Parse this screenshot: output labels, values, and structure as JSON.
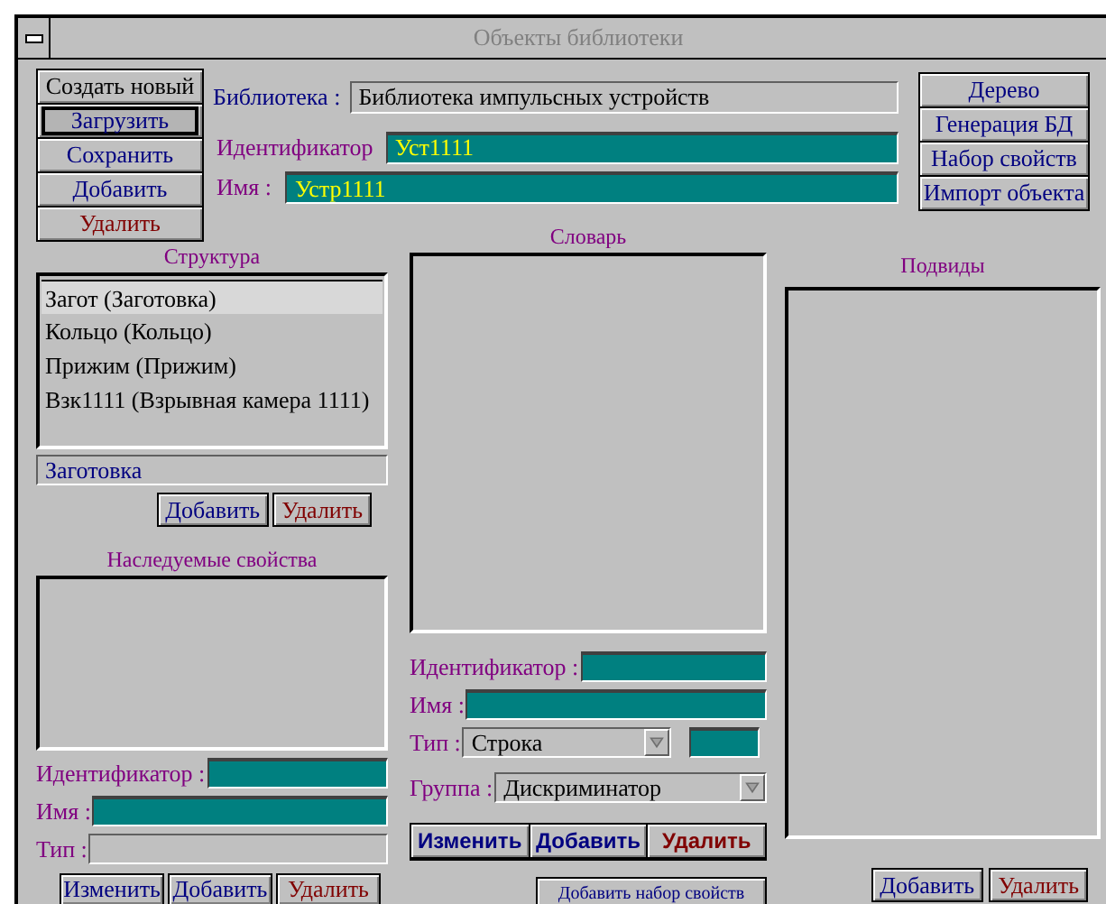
{
  "window": {
    "title": "Объекты библиотеки"
  },
  "main_buttons": [
    {
      "label": "Создать новый",
      "kind": "plain",
      "focused": false
    },
    {
      "label": "Загрузить",
      "kind": "action",
      "focused": true
    },
    {
      "label": "Сохранить",
      "kind": "action",
      "focused": false
    },
    {
      "label": "Добавить",
      "kind": "action",
      "focused": false
    },
    {
      "label": "Удалить",
      "kind": "danger",
      "focused": false
    }
  ],
  "library": {
    "label": "Библиотека :",
    "value": "Библиотека импульсных устройств"
  },
  "identifier": {
    "label": "Идентификатор",
    "value": "Уст1111"
  },
  "name": {
    "label": "Имя :",
    "value": "Устр1111"
  },
  "side_buttons": [
    "Дерево",
    "Генерация БД",
    "Набор свойств",
    "Импорт объекта"
  ],
  "structure": {
    "title": "Структура",
    "items": [
      {
        "text": "Загот (Заготовка)",
        "selected": true
      },
      {
        "text": "Кольцо (Кольцо)",
        "selected": false
      },
      {
        "text": "Прижим (Прижим)",
        "selected": false
      },
      {
        "text": "Взк1111 (Взрывная камера 1111)",
        "selected": false
      }
    ],
    "field": {
      "value": "Заготовка"
    },
    "buttons": [
      {
        "label": "Добавить",
        "kind": "action"
      },
      {
        "label": "Удалить",
        "kind": "danger"
      }
    ]
  },
  "inherited": {
    "title": "Наследуемые свойства",
    "fields": [
      {
        "label": "Идентификатор :",
        "disabled": false
      },
      {
        "label": "Имя :",
        "disabled": false
      },
      {
        "label": "Тип :",
        "disabled": true
      }
    ],
    "buttons": [
      {
        "label": "Изменить",
        "kind": "action"
      },
      {
        "label": "Добавить",
        "kind": "action"
      },
      {
        "label": "Удалить",
        "kind": "danger"
      }
    ]
  },
  "dictionary": {
    "title": "Словарь",
    "identifier": {
      "label": "Идентификатор :"
    },
    "name": {
      "label": "Имя :"
    },
    "type": {
      "label": "Тип :",
      "value": "Строка"
    },
    "group": {
      "label": "Группа :",
      "value": "Дискриминатор"
    },
    "buttons": [
      {
        "label": "Изменить",
        "kind": "action"
      },
      {
        "label": "Добавить",
        "kind": "action"
      },
      {
        "label": "Удалить",
        "kind": "danger"
      }
    ],
    "add_set_button": "Добавить набор свойств"
  },
  "subtypes": {
    "title": "Подвиды",
    "buttons": [
      {
        "label": "Добавить",
        "kind": "action"
      },
      {
        "label": "Удалить",
        "kind": "danger"
      }
    ]
  }
}
